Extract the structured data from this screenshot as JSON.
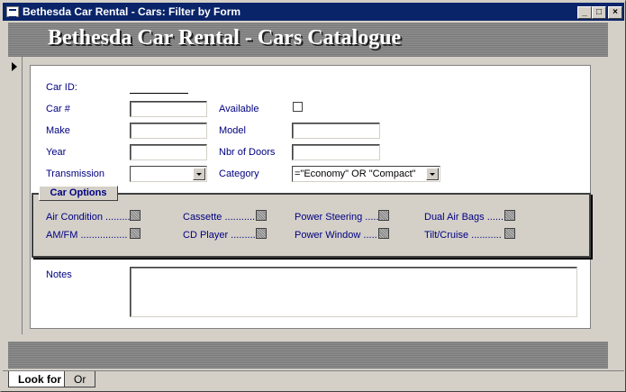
{
  "window": {
    "title": "Bethesda Car Rental - Cars: Filter by Form",
    "minimize": "_",
    "maximize": "□",
    "close": "×"
  },
  "header": {
    "title": "Bethesda Car Rental - Cars Catalogue"
  },
  "form": {
    "car_id_label": "Car ID:",
    "car_no_label": "Car #",
    "available_label": "Available",
    "make_label": "Make",
    "model_label": "Model",
    "year_label": "Year",
    "doors_label": "Nbr of Doors",
    "transmission_label": "Transmission",
    "category_label": "Category",
    "category_value": "=\"Economy\" OR \"Compact\"",
    "notes_label": "Notes"
  },
  "options": {
    "title": "Car Options",
    "items": [
      "Air Condition ..........",
      "Cassette ...........",
      "Power Steering .....",
      "Dual Air Bags ......",
      "AM/FM .................",
      "CD Player ..........",
      "Power Window .....",
      "Tilt/Cruise ..........."
    ]
  },
  "tabs": [
    "Look for",
    "Or"
  ],
  "icons": {
    "window": "form-icon",
    "selector": "record-selector-arrow-icon"
  }
}
